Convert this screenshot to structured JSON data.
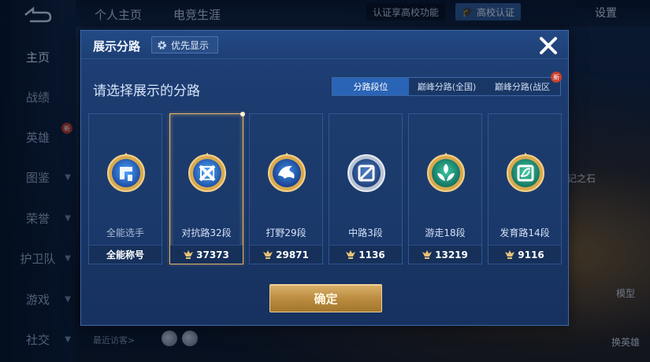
{
  "background": {
    "nav_items": [
      {
        "label": "主页",
        "active": true
      },
      {
        "label": "战绩"
      },
      {
        "label": "英雄"
      },
      {
        "label": "图鉴"
      },
      {
        "label": "荣誉"
      },
      {
        "label": "护卫队"
      },
      {
        "label": "游戏"
      },
      {
        "label": "社交"
      }
    ],
    "top_tabs": [
      "个人主页",
      "电竞生涯"
    ],
    "campus_tip": "认证享高校功能",
    "campus_button": "高校认证",
    "settings": "设置",
    "recent_visitors": "最近访客>",
    "side_texts": [
      "记之石",
      "模型",
      "换英雄"
    ]
  },
  "modal": {
    "title": "展示分路",
    "priority_label": "优先显示",
    "subtitle": "请选择展示的分路",
    "tabs": [
      {
        "label": "分路段位",
        "active": true
      },
      {
        "label": "巅峰分路(全国)"
      },
      {
        "label": "巅峰分路(战区",
        "badge": "新"
      }
    ],
    "cards": [
      {
        "name": "全能选手",
        "footer": "全能称号",
        "emblem": "all-round-emblem-icon",
        "selected": false
      },
      {
        "name": "对抗路32段",
        "footer": "37373",
        "emblem": "clash-lane-emblem-icon",
        "selected": true
      },
      {
        "name": "打野29段",
        "footer": "29871",
        "emblem": "jungle-emblem-icon",
        "selected": false
      },
      {
        "name": "中路3段",
        "footer": "1136",
        "emblem": "mid-lane-emblem-icon",
        "selected": false
      },
      {
        "name": "游走18段",
        "footer": "13219",
        "emblem": "roam-emblem-icon",
        "selected": false
      },
      {
        "name": "发育路14段",
        "footer": "9116",
        "emblem": "farm-lane-emblem-icon",
        "selected": false
      }
    ],
    "confirm_label": "确定"
  },
  "colors": {
    "accent_gold": "#e0b46a",
    "tab_active": "#2a64b6",
    "modal_bg": "#1d3c6e"
  }
}
